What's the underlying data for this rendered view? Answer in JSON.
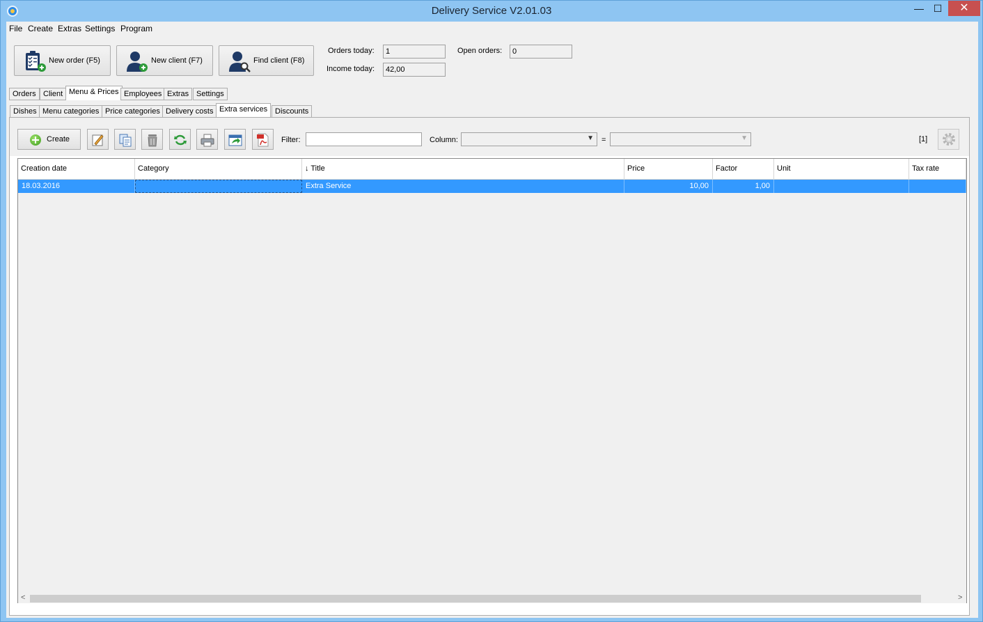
{
  "window": {
    "title": "Delivery Service V2.01.03",
    "min": "—",
    "max": "☐",
    "close": "✕"
  },
  "menu": [
    "File",
    "Create",
    "Extras",
    "Settings",
    "Program"
  ],
  "quick_actions": {
    "new_order": "New order (F5)",
    "new_client": "New client (F7)",
    "find_client": "Find client (F8)"
  },
  "stats": {
    "orders_today_label": "Orders today:",
    "orders_today": "1",
    "income_today_label": "Income today:",
    "income_today": "42,00",
    "open_orders_label": "Open orders:",
    "open_orders": "0"
  },
  "main_tabs": [
    "Orders",
    "Client",
    "Menu & Prices",
    "Employees",
    "Extras",
    "Settings"
  ],
  "main_tab_active": "Menu & Prices",
  "sub_tabs": [
    "Dishes",
    "Menu categories",
    "Price categories",
    "Delivery costs",
    "Extra services",
    "Discounts"
  ],
  "sub_tab_active": "Extra services",
  "toolbar": {
    "create": "Create",
    "filter_label": "Filter:",
    "filter_value": "",
    "column_label": "Column:",
    "column_value": "",
    "equals": "=",
    "value_value": "",
    "record_count": "[1]",
    "icons": [
      "edit-icon",
      "copy-icon",
      "delete-icon",
      "refresh-icon",
      "print-icon",
      "export-icon",
      "pdf-icon",
      "settings-gear-icon"
    ]
  },
  "table": {
    "sorted_column": "Title",
    "sort_direction": "descending",
    "columns": [
      "Creation date",
      "Category",
      "↓ Title",
      "Price",
      "Factor",
      "Unit",
      "Tax rate"
    ],
    "rows": [
      {
        "creation_date": "18.03.2016",
        "category": "",
        "title": "Extra Service",
        "price": "10,00",
        "factor": "1,00",
        "unit": "",
        "tax_rate": ""
      }
    ]
  },
  "colors": {
    "title_bar": "#8ec5f2",
    "selection": "#3399ff",
    "surface": "#f0f0f0"
  }
}
